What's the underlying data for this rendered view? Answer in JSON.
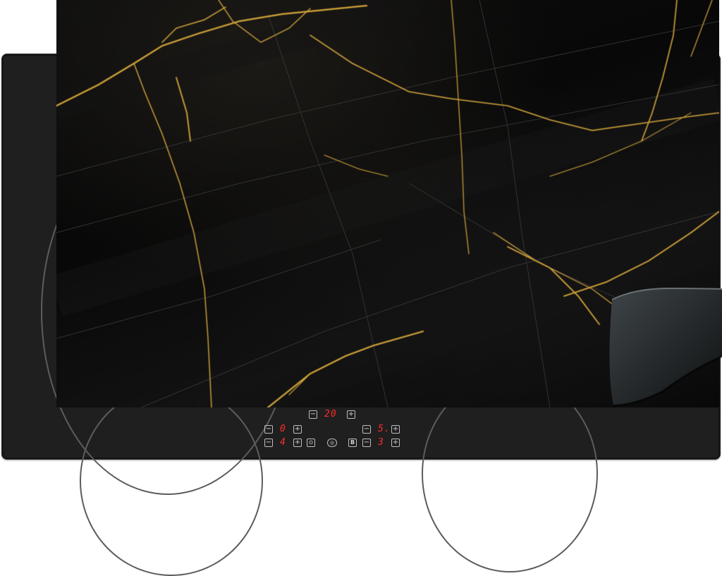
{
  "cooktop": {
    "timer_display": "20",
    "zones": [
      {
        "id": "front-left",
        "level": "0"
      },
      {
        "id": "rear-left",
        "level": "4"
      },
      {
        "id": "front-right",
        "level": "5."
      },
      {
        "id": "rear-right",
        "level": "3"
      }
    ],
    "icons": {
      "minus": "−",
      "plus": "+",
      "lock": "⊙",
      "dual": "◎",
      "booster": "B"
    }
  },
  "colors": {
    "marble_base": "#0a0a0a",
    "gold_vein": "#d4a63a",
    "display_red": "#ff2b2b",
    "cooktop_body": "#1f1f1f"
  }
}
